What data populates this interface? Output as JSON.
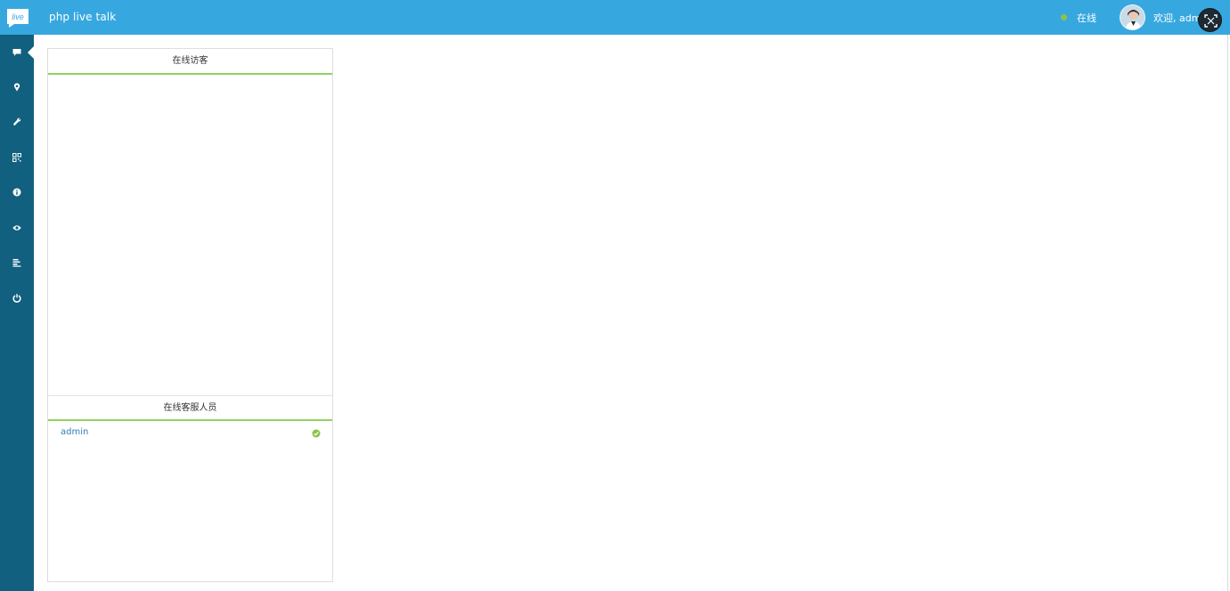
{
  "header": {
    "logo_text": "live",
    "brand": "php live talk",
    "status_label": "在线",
    "welcome_text": "欢迎, admin",
    "accent_color": "#37a8df",
    "status_color": "#8bc34a"
  },
  "sidebar": {
    "background": "#11607f",
    "items": [
      {
        "icon": "chat-icon",
        "active": true
      },
      {
        "icon": "map-marker-icon",
        "active": false
      },
      {
        "icon": "wrench-icon",
        "active": false
      },
      {
        "icon": "qrcode-icon",
        "active": false
      },
      {
        "icon": "info-icon",
        "active": false
      },
      {
        "icon": "eye-icon",
        "active": false
      },
      {
        "icon": "list-icon",
        "active": false
      },
      {
        "icon": "power-icon",
        "active": false
      }
    ]
  },
  "panel": {
    "visitors_title": "在线访客",
    "visitors": [],
    "agents_title": "在线客服人员",
    "agents": [
      {
        "name": "admin",
        "status": "online"
      }
    ]
  }
}
